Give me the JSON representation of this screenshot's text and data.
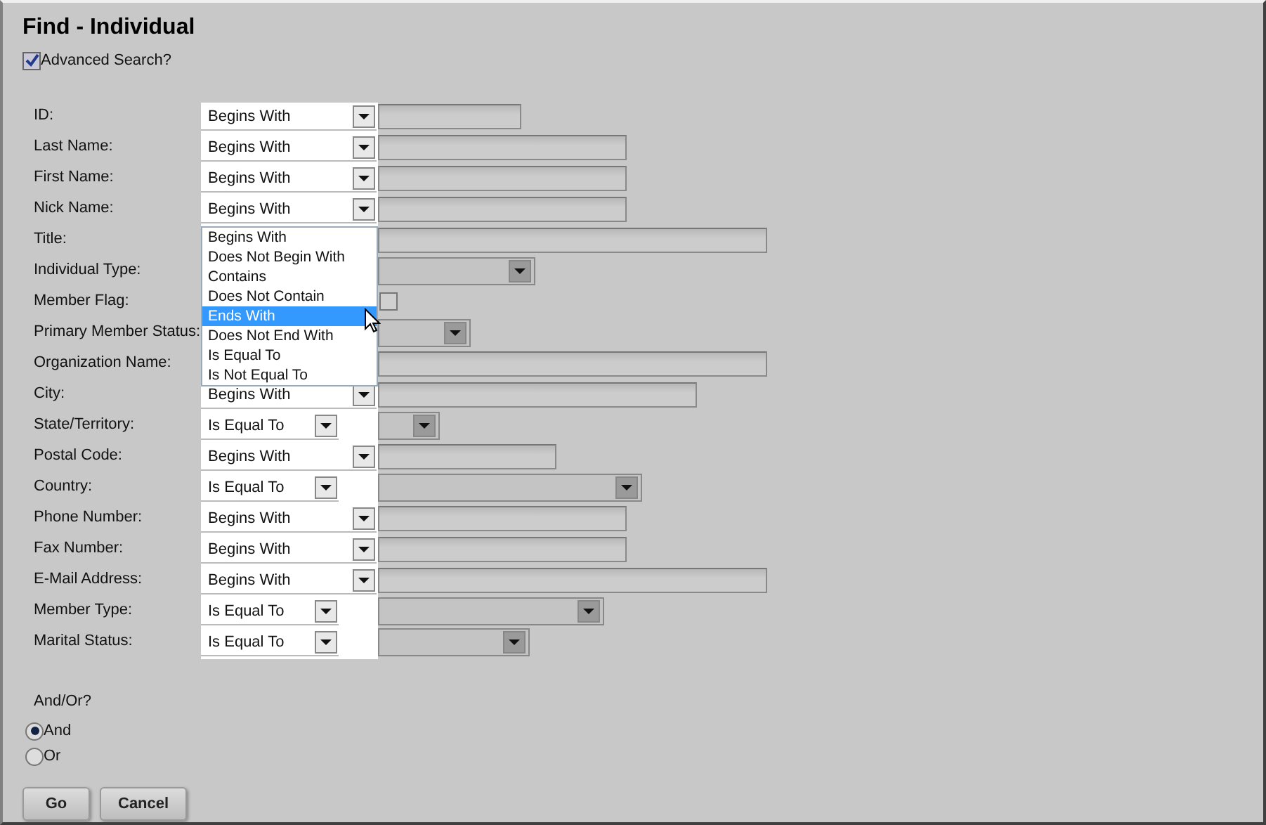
{
  "window": {
    "title": "Find - Individual"
  },
  "advanced_search": {
    "label": "Advanced Search?",
    "checked": true
  },
  "fields": [
    {
      "label": "ID:",
      "kind": "text",
      "operator": "Begins With"
    },
    {
      "label": "Last Name:",
      "kind": "text",
      "operator": "Begins With"
    },
    {
      "label": "First Name:",
      "kind": "text",
      "operator": "Begins With"
    },
    {
      "label": "Nick Name:",
      "kind": "text",
      "operator": "Begins With",
      "dropdown_open": true,
      "options": [
        {
          "label": "Begins With",
          "selected": false
        },
        {
          "label": "Does Not Begin With",
          "selected": false
        },
        {
          "label": "Contains",
          "selected": false
        },
        {
          "label": "Does Not Contain",
          "selected": false
        },
        {
          "label": "Ends With",
          "selected": true
        },
        {
          "label": "Does Not End With",
          "selected": false
        },
        {
          "label": "Is Equal To",
          "selected": false
        },
        {
          "label": "Is Not Equal To",
          "selected": false
        }
      ]
    },
    {
      "label": "Title:",
      "kind": "text"
    },
    {
      "label": "Individual Type:",
      "kind": "select"
    },
    {
      "label": "Member Flag:",
      "kind": "checkbox",
      "checked": false
    },
    {
      "label": "Primary Member Status:",
      "kind": "select"
    },
    {
      "label": "Organization Name:",
      "kind": "text"
    },
    {
      "label": "City:",
      "kind": "text",
      "operator": "Begins With"
    },
    {
      "label": "State/Territory:",
      "kind": "select",
      "operator": "Is Equal To"
    },
    {
      "label": "Postal Code:",
      "kind": "text",
      "operator": "Begins With"
    },
    {
      "label": "Country:",
      "kind": "select",
      "operator": "Is Equal To"
    },
    {
      "label": "Phone Number:",
      "kind": "text",
      "operator": "Begins With"
    },
    {
      "label": "Fax Number:",
      "kind": "text",
      "operator": "Begins With"
    },
    {
      "label": "E-Mail Address:",
      "kind": "text",
      "operator": "Begins With"
    },
    {
      "label": "Member Type:",
      "kind": "select",
      "operator": "Is Equal To"
    },
    {
      "label": "Marital Status:",
      "kind": "select",
      "operator": "Is Equal To"
    }
  ],
  "and_or": {
    "label": "And/Or?",
    "options": [
      {
        "label": "And",
        "selected": true
      },
      {
        "label": "Or",
        "selected": false
      }
    ]
  },
  "buttons": [
    "Go",
    "Cancel"
  ]
}
